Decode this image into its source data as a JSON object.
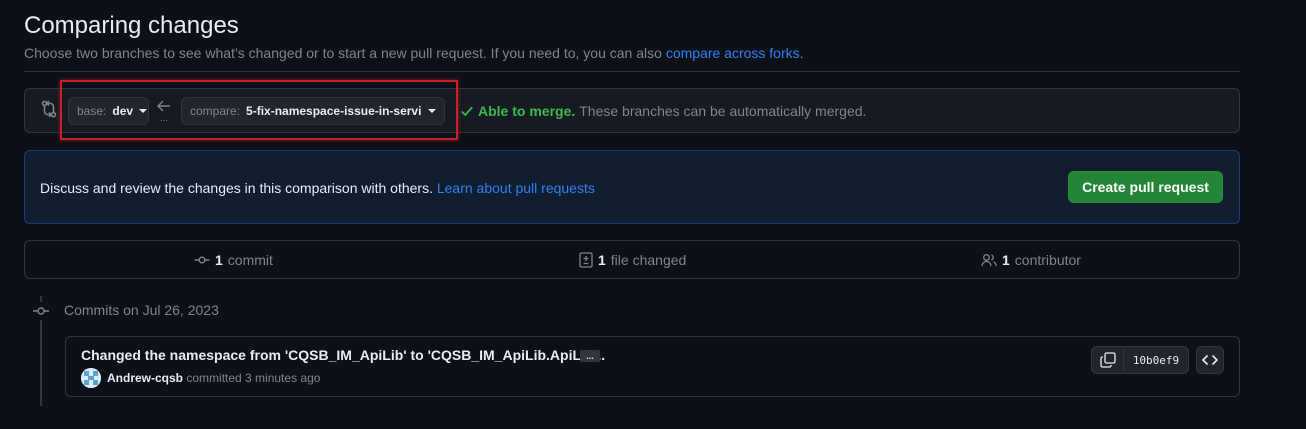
{
  "header": {
    "title": "Comparing changes",
    "subtitle": "Choose two branches to see what’s changed or to start a new pull request. If you need to, you can also ",
    "subtitle_link": "compare across forks",
    "subtitle_end": "."
  },
  "range": {
    "base_label": "base:",
    "base_value": "dev",
    "compare_label": "compare:",
    "compare_value": "5-fix-namespace-issue-in-servi...",
    "dots": "...",
    "merge_status": "Able to merge.",
    "merge_desc": "These branches can be automatically merged."
  },
  "discuss": {
    "text": "Discuss and review the changes in this comparison with others. ",
    "link": "Learn about pull requests",
    "button": "Create pull request"
  },
  "stats": {
    "commits_count": "1",
    "commits_label": "commit",
    "files_count": "1",
    "files_label": "file changed",
    "contributors_count": "1",
    "contributors_label": "contributor"
  },
  "commits": {
    "date_heading": "Commits on Jul 26, 2023",
    "items": [
      {
        "message": "Changed the namespace from 'CQSB_IM_ApiLib' to 'CQSB_IM_ApiLib.ApiLib...",
        "ellipsis": "...",
        "author": "Andrew-cqsb",
        "committed": "committed 3 minutes ago",
        "sha": "10b0ef9"
      }
    ]
  },
  "colors": {
    "background": "#0d1117",
    "accent_link": "#2f81f7",
    "success": "#3fb950",
    "primary_button": "#238636",
    "highlight_box": "#c9202b"
  },
  "icons": [
    "git-compare-icon",
    "arrow-left-icon",
    "check-icon",
    "git-commit-icon",
    "file-diff-icon",
    "people-icon",
    "copy-icon",
    "code-icon",
    "avatar"
  ]
}
